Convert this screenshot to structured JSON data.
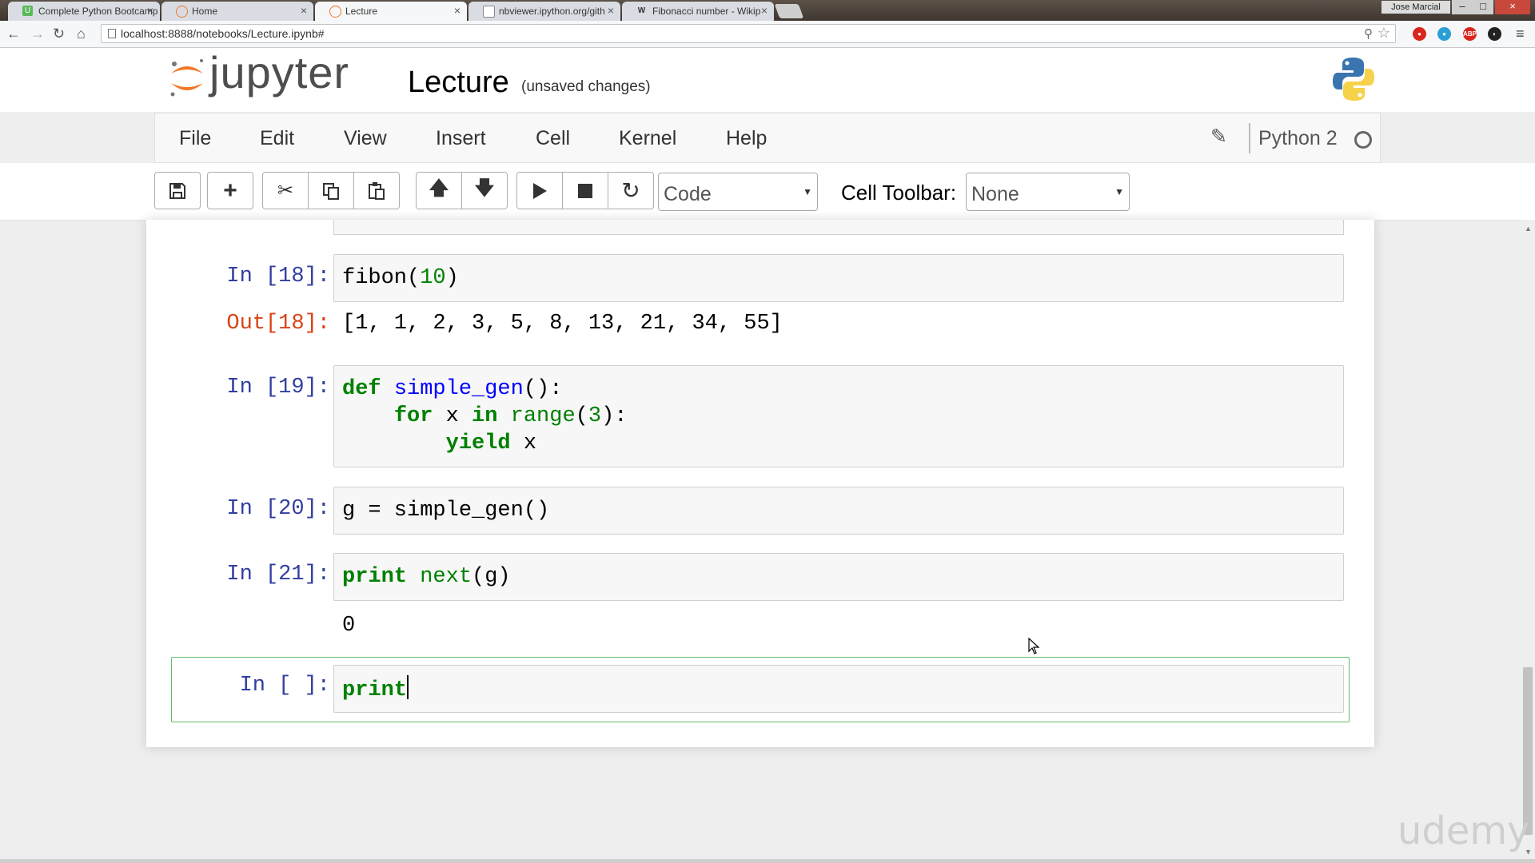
{
  "browser": {
    "tabs": [
      {
        "label": "Complete Python Bootcamp",
        "icon": "udemy-icon",
        "color": "#5cb85c"
      },
      {
        "label": "Home",
        "icon": "jupyter-icon",
        "color": "#f37726"
      },
      {
        "label": "Lecture",
        "icon": "jupyter-icon",
        "color": "#f37726"
      },
      {
        "label": "nbviewer.ipython.org/gith",
        "icon": "page-icon",
        "color": "#777777"
      },
      {
        "label": "Fibonacci number - Wikip",
        "icon": "wikipedia-icon",
        "color": "#555555"
      }
    ],
    "user": "Jose Marcial",
    "url": "localhost:8888/notebooks/Lecture.ipynb#"
  },
  "header": {
    "brand": "jupyter",
    "notebook_name": "Lecture",
    "autosave": "(unsaved changes)"
  },
  "menubar": {
    "items": [
      "File",
      "Edit",
      "View",
      "Insert",
      "Cell",
      "Kernel",
      "Help"
    ],
    "kernel": "Python 2"
  },
  "toolbar": {
    "cell_type": "Code",
    "cell_toolbar_label": "Cell Toolbar:",
    "cell_toolbar_value": "None"
  },
  "cells": [
    {
      "prompt": "In [18]:",
      "code": "fibon(10)",
      "out_prompt": "Out[18]:",
      "output": "[1, 1, 2, 3, 5, 8, 13, 21, 34, 55]"
    },
    {
      "prompt": "In [19]:",
      "code": "def simple_gen():\n    for x in range(3):\n        yield x"
    },
    {
      "prompt": "In [20]:",
      "code": "g = simple_gen()"
    },
    {
      "prompt": "In [21]:",
      "code": "print next(g)",
      "output": "0"
    },
    {
      "prompt": "In [ ]:",
      "code": "print",
      "selected": true
    }
  ],
  "watermark": "udemy",
  "colors": {
    "selected_border": "#66bb6a",
    "in_prompt": "#303f9f",
    "out_prompt": "#d84315",
    "keyword": "#008000",
    "function": "#0000ff"
  }
}
